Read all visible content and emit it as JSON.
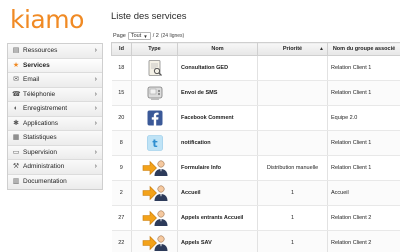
{
  "app": {
    "logo": "kiamo"
  },
  "sidebar": {
    "items": [
      {
        "label": "Ressources",
        "icon": "id-card-icon",
        "glyph": "▤",
        "has_submenu": true
      },
      {
        "label": "Services",
        "icon": "star-icon",
        "glyph": "★",
        "has_submenu": false,
        "active": true
      },
      {
        "label": "Email",
        "icon": "envelope-icon",
        "glyph": "✉",
        "has_submenu": true
      },
      {
        "label": "Téléphonie",
        "icon": "phone-icon",
        "glyph": "☎",
        "has_submenu": true
      },
      {
        "label": "Enregistrement",
        "icon": "headset-icon",
        "glyph": "◐",
        "has_submenu": true
      },
      {
        "label": "Applications",
        "icon": "gear-icon",
        "glyph": "✱",
        "has_submenu": true
      },
      {
        "label": "Statistiques",
        "icon": "chart-icon",
        "glyph": "▦",
        "has_submenu": false
      },
      {
        "label": "Supervision",
        "icon": "monitor-icon",
        "glyph": "▭",
        "has_submenu": true
      },
      {
        "label": "Administration",
        "icon": "tools-icon",
        "glyph": "⚒",
        "has_submenu": true
      },
      {
        "label": "Documentation",
        "icon": "book-icon",
        "glyph": "▥",
        "has_submenu": false
      }
    ]
  },
  "main": {
    "title": "Liste des services",
    "pager": {
      "page_label": "Page",
      "page_value": "Tout",
      "page_total": "/ 2",
      "row_count": "(24 lignes)"
    },
    "table": {
      "columns": [
        "Id",
        "Type",
        "Nom",
        "Priorité",
        "Nom du groupe associé"
      ],
      "sort_indicator": "▲",
      "rows": [
        {
          "id": "18",
          "type_icon": "document-icon",
          "name": "Consultation GED",
          "priority": "",
          "group": "Relation Client 1"
        },
        {
          "id": "15",
          "type_icon": "sms-phone-icon",
          "name": "Envoi de SMS",
          "priority": "",
          "group": "Relation Client 1"
        },
        {
          "id": "20",
          "type_icon": "facebook-icon",
          "name": "Facebook Comment",
          "priority": "",
          "group": "Equipe 2.0"
        },
        {
          "id": "8",
          "type_icon": "twitter-icon",
          "name": "notification",
          "priority": "",
          "group": "Relation Client 1"
        },
        {
          "id": "9",
          "type_icon": "incoming-agent-icon",
          "name": "Formulaire Info",
          "priority": "Distribution manuelle",
          "group": "Relation Client 1"
        },
        {
          "id": "2",
          "type_icon": "incoming-agent-icon",
          "name": "Accueil",
          "priority": "1",
          "group": "Accueil"
        },
        {
          "id": "27",
          "type_icon": "incoming-agent-icon",
          "name": "Appels entrants Accueil",
          "priority": "1",
          "group": "Relation Client 2"
        },
        {
          "id": "22",
          "type_icon": "incoming-agent-icon",
          "name": "Appels SAV",
          "priority": "1",
          "group": "Relation Client 2"
        }
      ]
    }
  },
  "colors": {
    "brand": "#f08a24",
    "facebook": "#3b5998",
    "twitter": "#4aa3df"
  }
}
